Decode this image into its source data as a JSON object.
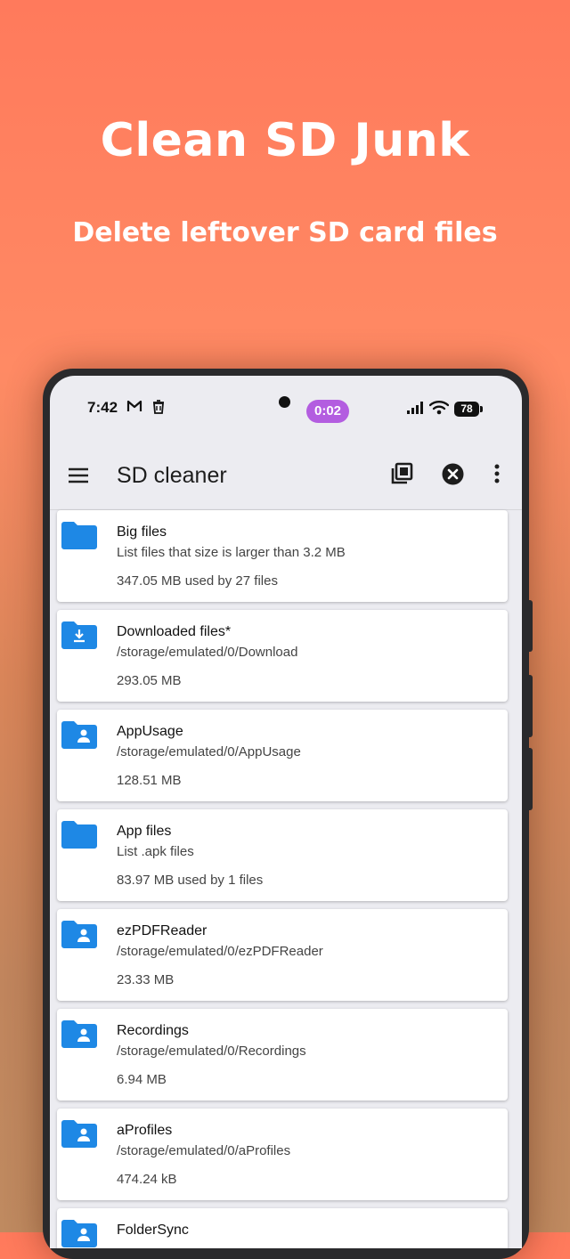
{
  "promo": {
    "headline": "Clean SD Junk",
    "subline": "Delete leftover SD card files"
  },
  "status_bar": {
    "time": "7:42",
    "notification_icons": [
      "gmail-icon",
      "trash-can-icon"
    ],
    "timer": "0:02",
    "battery": "78"
  },
  "app_bar": {
    "title": "SD cleaner",
    "icons": [
      "menu-icon",
      "app-grid-icon",
      "close-circle-icon",
      "more-vert-icon"
    ]
  },
  "items": [
    {
      "name": "Big files",
      "desc": "List files that size is larger than 3.2 MB",
      "size": "347.05 MB used by 27 files",
      "icon": "folder-icon"
    },
    {
      "name": "Downloaded files*",
      "desc": "/storage/emulated/0/Download",
      "size": "293.05 MB",
      "icon": "download-folder-icon"
    },
    {
      "name": "AppUsage",
      "desc": "/storage/emulated/0/AppUsage",
      "size": "128.51 MB",
      "icon": "user-folder-icon"
    },
    {
      "name": "App files",
      "desc": "List .apk files",
      "size": "83.97 MB used by 1 files",
      "icon": "folder-icon"
    },
    {
      "name": "ezPDFReader",
      "desc": "/storage/emulated/0/ezPDFReader",
      "size": "23.33 MB",
      "icon": "user-folder-icon"
    },
    {
      "name": "Recordings",
      "desc": "/storage/emulated/0/Recordings",
      "size": "6.94 MB",
      "icon": "user-folder-icon"
    },
    {
      "name": "aProfiles",
      "desc": "/storage/emulated/0/aProfiles",
      "size": "474.24 kB",
      "icon": "user-folder-icon"
    },
    {
      "name": "FolderSync",
      "desc": "",
      "size": "",
      "icon": "user-folder-icon"
    }
  ],
  "colors": {
    "accent_folder": "#1e88e5",
    "timer_pill": "#b35de0"
  }
}
